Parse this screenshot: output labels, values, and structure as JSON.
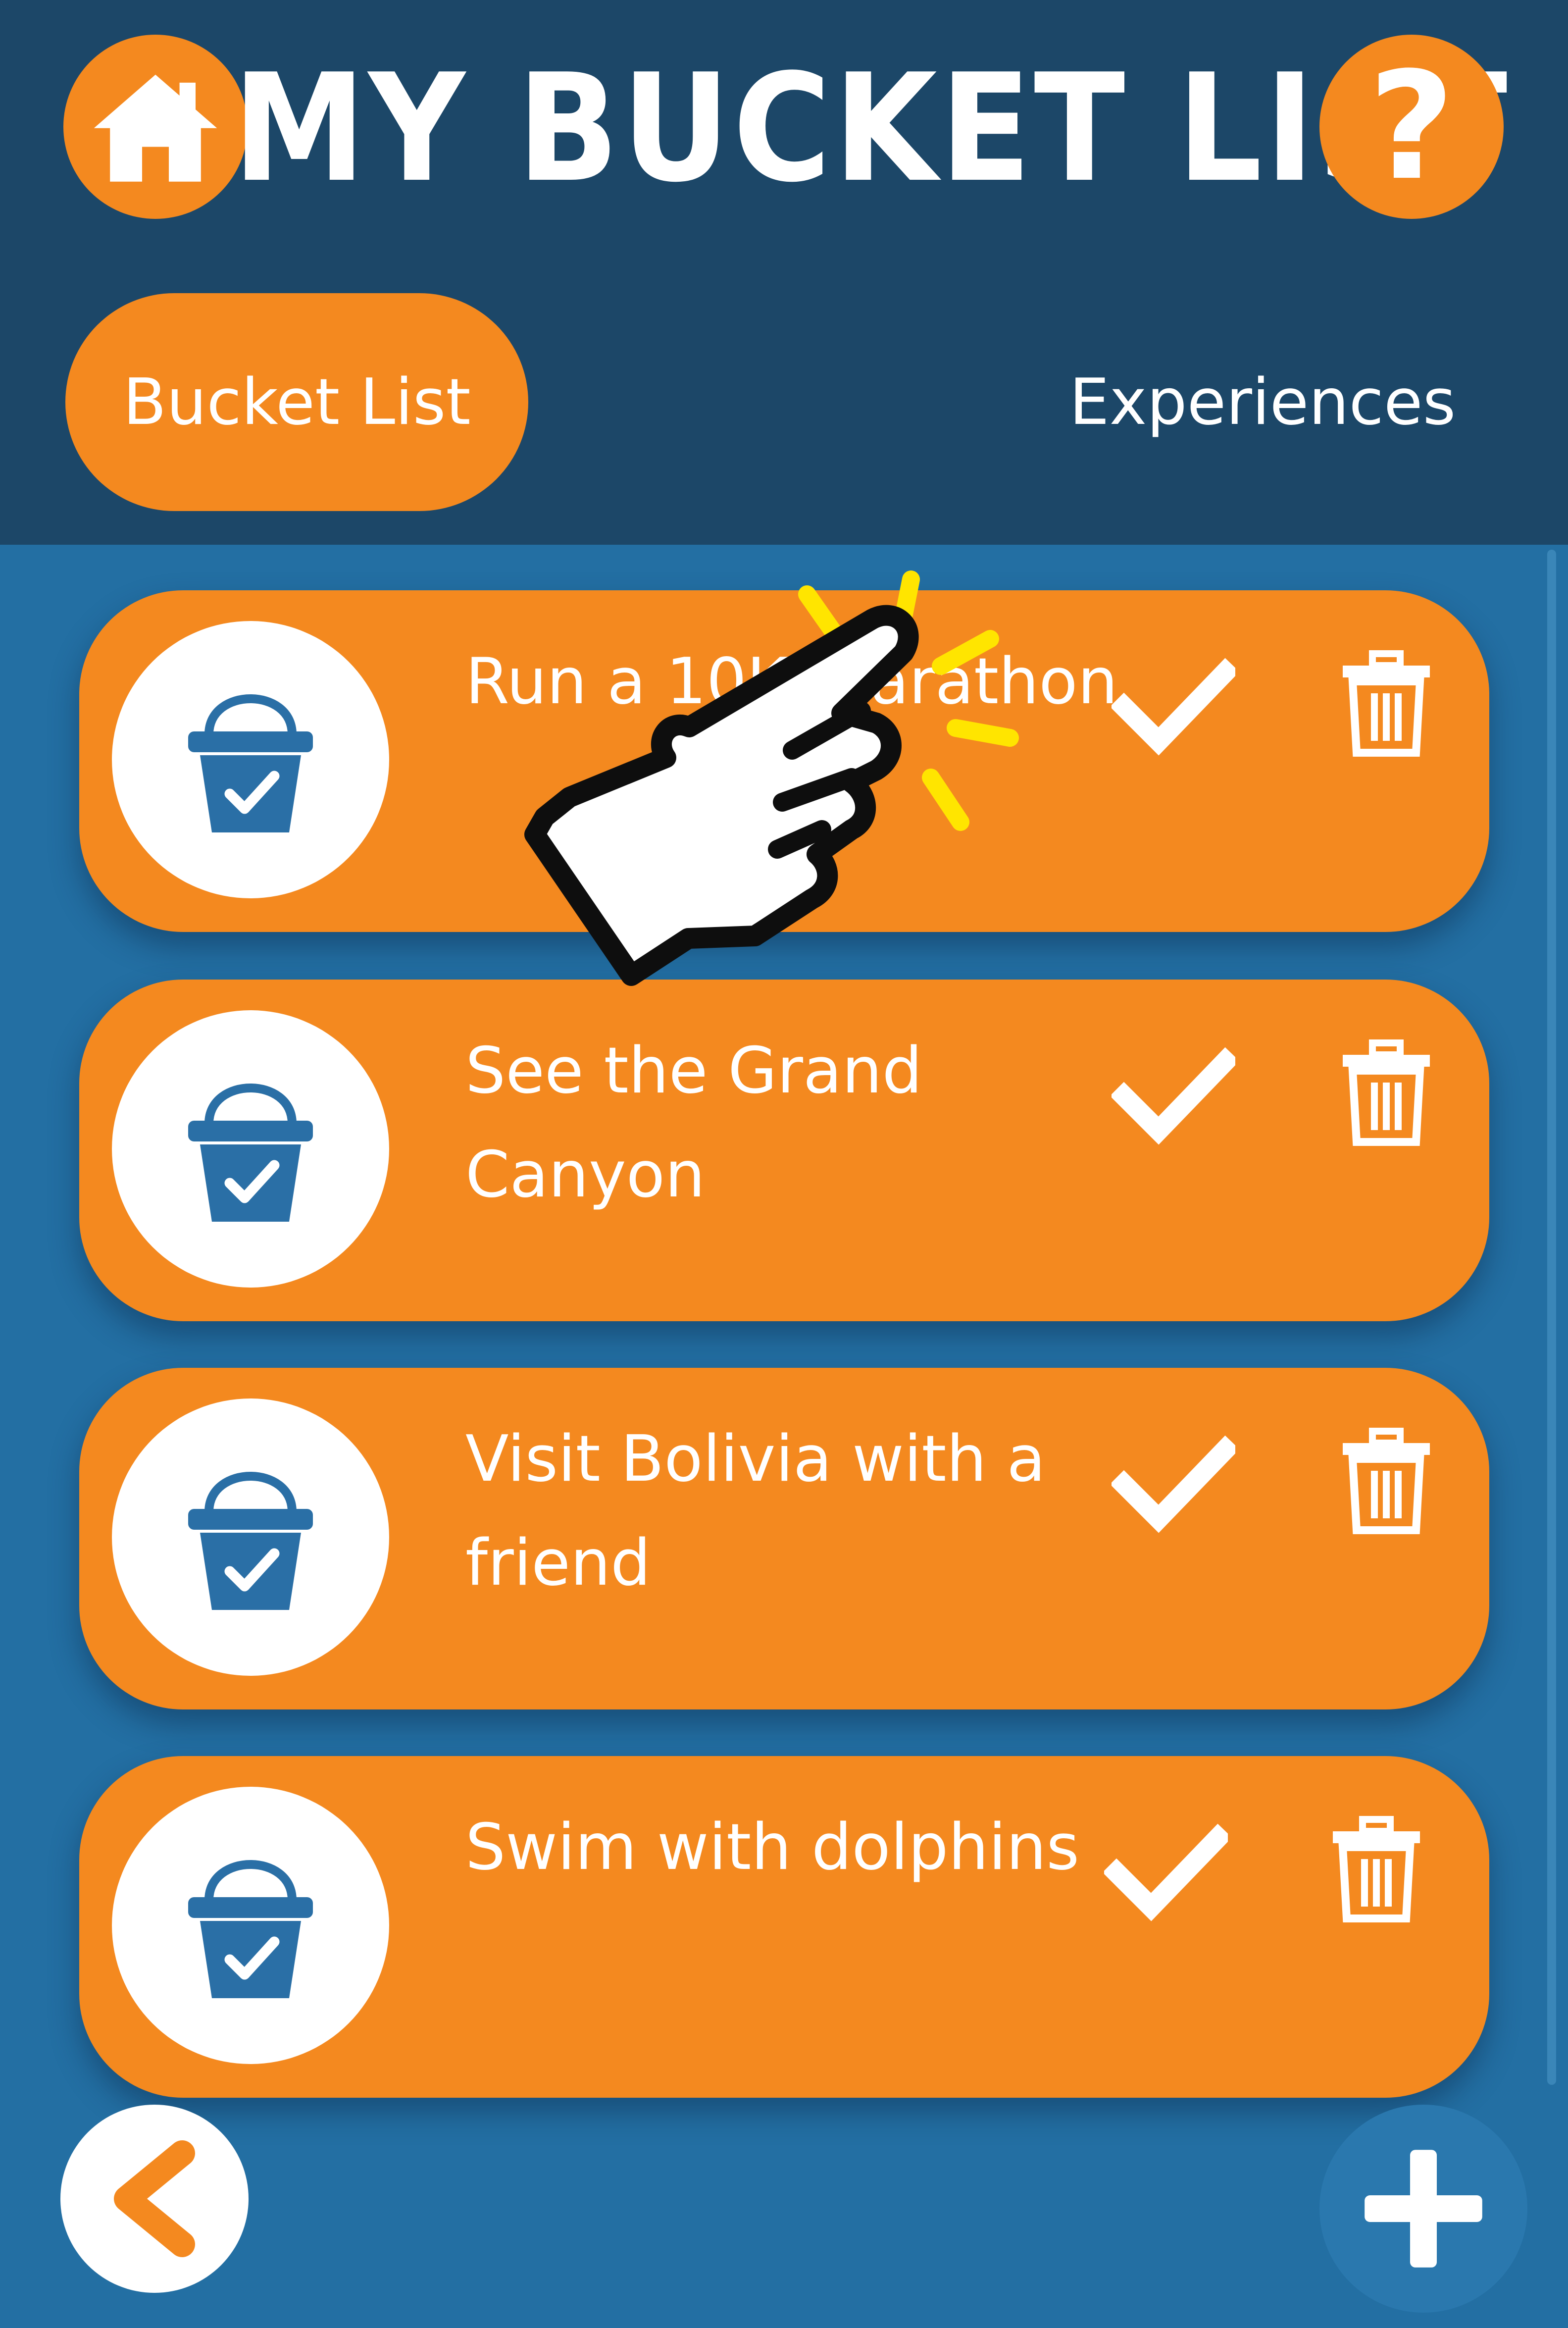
{
  "header": {
    "title": "MY BUCKET LIST",
    "help_symbol": "?",
    "home_icon": "home-icon",
    "help_icon": "question-icon"
  },
  "tabs": [
    {
      "label": "Bucket List",
      "active": true
    },
    {
      "label": "Experiences",
      "active": false
    }
  ],
  "items": [
    {
      "text": "Run a 10K marathon",
      "icon": "bucket-check-icon"
    },
    {
      "text": "See the Grand Canyon",
      "icon": "bucket-check-icon"
    },
    {
      "text": "Visit Bolivia with a friend",
      "icon": "bucket-check-icon"
    },
    {
      "text": "Swim with dolphins",
      "icon": "bucket-check-icon"
    }
  ],
  "item_actions": {
    "complete_icon": "checkmark-icon",
    "delete_icon": "trash-icon"
  },
  "footer": {
    "back_icon": "chevron-left-icon",
    "add_icon": "plus-icon"
  },
  "overlay": {
    "icon": "tap-hand-pointer-icon"
  },
  "colors": {
    "header_bg": "#1c4768",
    "body_bg": "#236fa3",
    "accent_orange": "#f4891f",
    "bucket_blue": "#2a6fa6",
    "white": "#ffffff",
    "tap_spark": "#ffe500"
  }
}
